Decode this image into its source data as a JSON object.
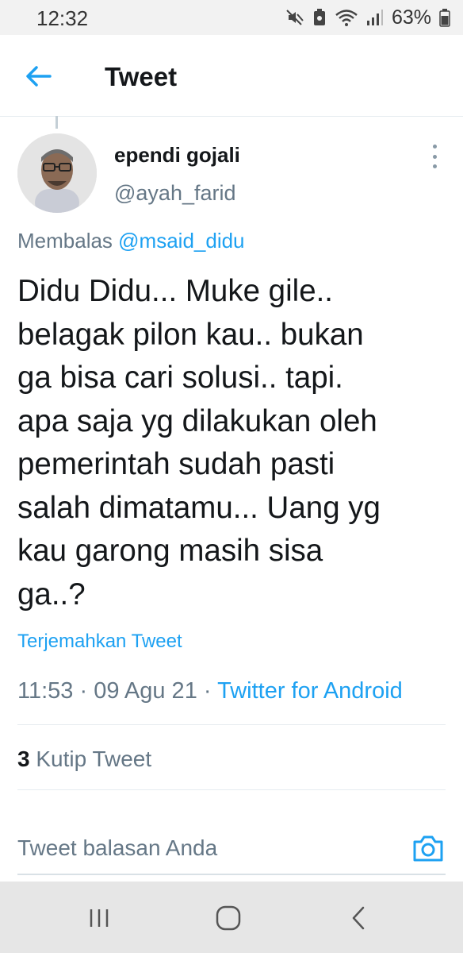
{
  "status_bar": {
    "time": "12:32",
    "battery": "63%",
    "icons": [
      "mute-icon",
      "saver-icon",
      "wifi-icon",
      "signal-icon",
      "battery-icon"
    ]
  },
  "header": {
    "title": "Tweet",
    "back_icon": "arrow-left-icon"
  },
  "tweet": {
    "author_name": "ependi gojali",
    "author_handle": "@ayah_farid",
    "reply_prefix": "Membalas ",
    "reply_handle": "@msaid_didu",
    "text_lines": [
      "Didu Didu... Muke gile..",
      "belagak pilon kau.. bukan",
      "ga bisa cari solusi.. tapi.",
      "apa saja yg dilakukan oleh",
      "pemerintah sudah pasti",
      "salah dimatamu... Uang yg",
      "kau garong masih sisa",
      "ga..?"
    ],
    "translate_label": "Terjemahkan Tweet",
    "timestamp": "11:53 · 09 Agu 21 · ",
    "source": "Twitter for Android",
    "quote_count": "3",
    "quote_label": " Kutip Tweet"
  },
  "reply": {
    "placeholder": "Tweet balasan Anda",
    "camera_icon": "camera-icon"
  },
  "nav": {
    "icons": [
      "recent-apps-icon",
      "home-icon",
      "back-icon"
    ]
  },
  "colors": {
    "accent": "#1da1f2",
    "secondary_text": "#657786",
    "primary_text": "#14171a"
  }
}
